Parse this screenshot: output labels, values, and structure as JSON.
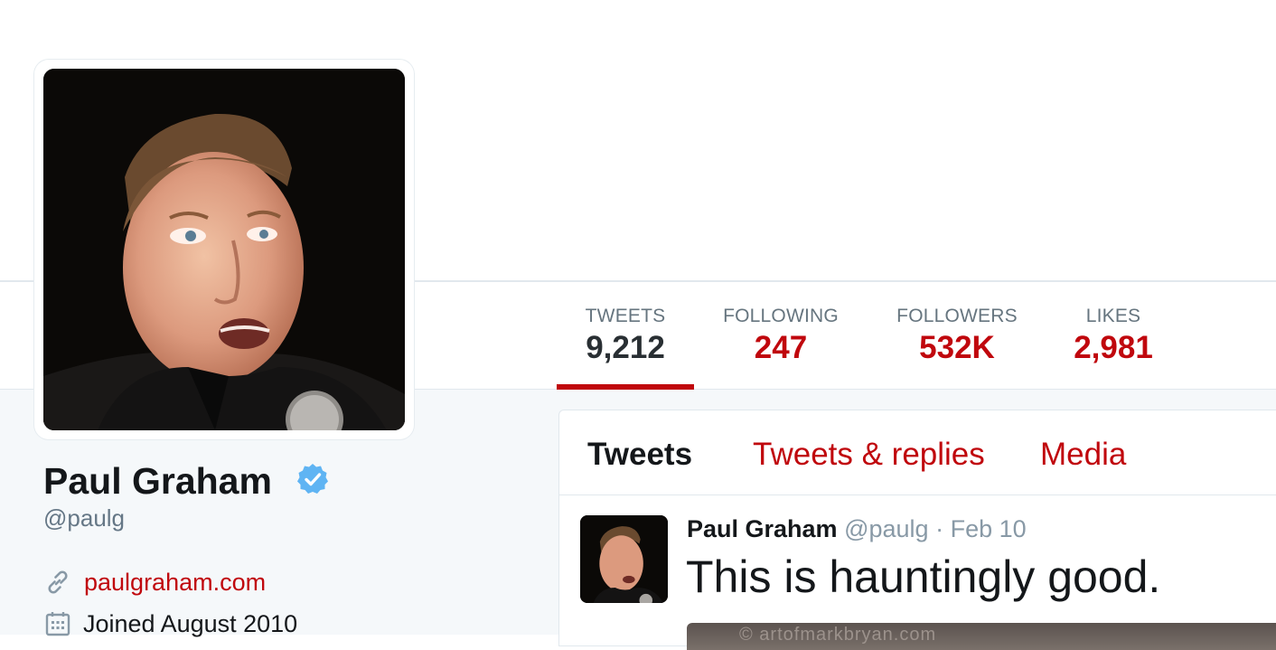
{
  "profile": {
    "name": "Paul Graham",
    "screen_name": "@paulg",
    "website": "paulgraham.com",
    "joined": "Joined August 2010",
    "verified": true
  },
  "stats": [
    {
      "label": "TWEETS",
      "value": "9,212",
      "active": true
    },
    {
      "label": "FOLLOWING",
      "value": "247",
      "active": false
    },
    {
      "label": "FOLLOWERS",
      "value": "532K",
      "active": false
    },
    {
      "label": "LIKES",
      "value": "2,981",
      "active": false
    }
  ],
  "tabs": [
    {
      "label": "Tweets",
      "active": true
    },
    {
      "label": "Tweets & replies",
      "active": false
    },
    {
      "label": "Media",
      "active": false
    }
  ],
  "tweet": {
    "name": "Paul Graham",
    "handle": "@paulg",
    "separator": "·",
    "date": "Feb 10",
    "text": "This is hauntingly good.",
    "media_watermark": "© artofmarkbryan.com"
  },
  "colors": {
    "accent": "#c0070d",
    "text": "#14171a",
    "muted": "#657786",
    "verified": "#1da1f2"
  },
  "icons": {
    "website": "link-icon",
    "joined": "calendar-icon",
    "verified": "verified-badge-icon"
  }
}
